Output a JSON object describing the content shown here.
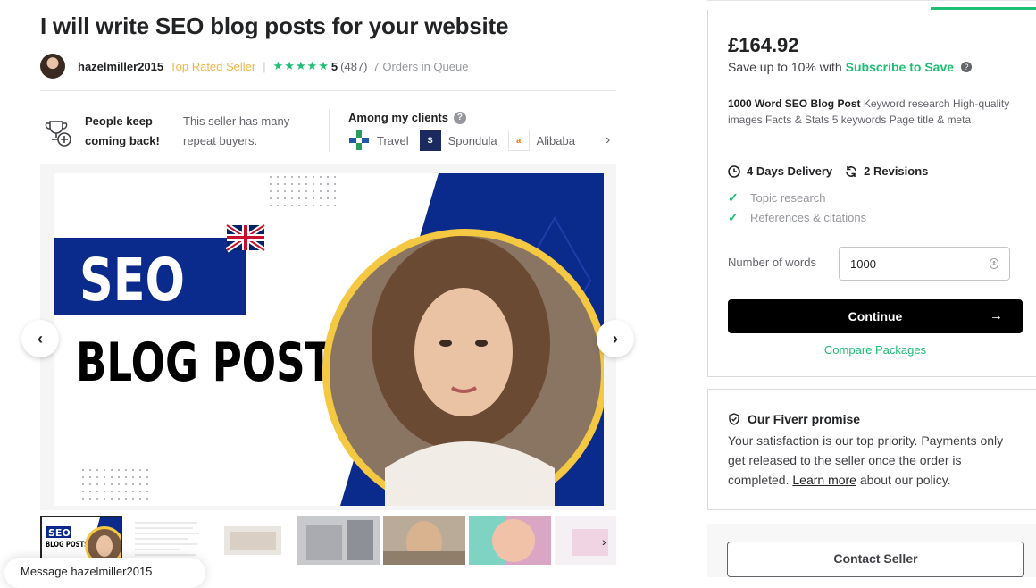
{
  "gig": {
    "title": "I will write SEO blog posts for your website"
  },
  "seller": {
    "username": "hazelmiller2015",
    "level": "Top Rated Seller",
    "separator": "|",
    "stars": "★★★★★",
    "rating": "5",
    "reviews": "(487)",
    "queue": "7 Orders in Queue"
  },
  "repeat_buyers": {
    "title": "People keep coming back!",
    "text": "This seller has many repeat buyers."
  },
  "clients": {
    "title": "Among my clients",
    "help": "?",
    "items": [
      {
        "name": "Travel",
        "logo": "travel-logo"
      },
      {
        "name": "Spondula",
        "logo": "spondula-logo"
      },
      {
        "name": "Alibaba",
        "logo": "alibaba-logo"
      }
    ],
    "next": "›"
  },
  "gallery": {
    "seo_text": "SEO",
    "blog_posts_text": "BLOG POSTS",
    "prev": "‹",
    "next": "›",
    "thumb_seo": "SEO",
    "thumb_blog": "BLOG POSTS",
    "thumbs_next": "›"
  },
  "message": {
    "label": "Message hazelmiller2015"
  },
  "package": {
    "price": "£164.92",
    "save_prefix": "Save up to 10% with",
    "save_link": "Subscribe to Save",
    "save_help": "?",
    "name": "1000 Word SEO Blog Post",
    "description": "Keyword research High-quality images Facts & Stats 5 keywords Page title & meta",
    "delivery": "4 Days Delivery",
    "revisions": "2 Revisions",
    "features": [
      "Topic research",
      "References & citations"
    ],
    "words_label": "Number of words",
    "words_value": "1000",
    "continue_label": "Continue",
    "continue_arrow": "→",
    "compare_label": "Compare Packages"
  },
  "promise": {
    "title": "Our Fiverr promise",
    "text_before": "Your satisfaction is our top priority. Payments only get released to the seller once the order is completed.",
    "link": "Learn more",
    "text_after": "about our policy."
  },
  "contact": {
    "label": "Contact Seller"
  },
  "colors": {
    "accent": "#1dbf73",
    "top_rated": "#f1b644",
    "seo_blue": "#0a2a8c",
    "button": "#000000"
  }
}
